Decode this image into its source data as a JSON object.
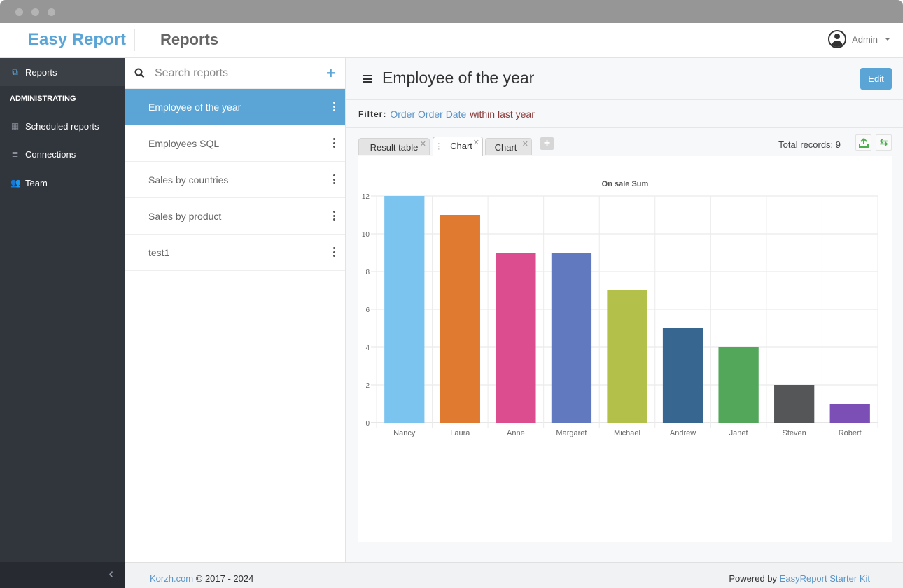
{
  "window": {
    "controls": [
      "close",
      "minimize",
      "maximize"
    ]
  },
  "header": {
    "brand": "Easy Report",
    "title": "Reports",
    "user": {
      "name": "Admin",
      "icon": "user-circle-icon"
    }
  },
  "sidebar": {
    "items": [
      {
        "label": "Reports",
        "icon": "reports-icon",
        "active": true
      }
    ],
    "section_heading": "ADMINISTRATING",
    "admin_items": [
      {
        "label": "Scheduled reports",
        "icon": "calendar-icon"
      },
      {
        "label": "Connections",
        "icon": "database-icon"
      },
      {
        "label": "Team",
        "icon": "users-icon"
      }
    ],
    "collapse_icon": "chevron-left-icon"
  },
  "report_list": {
    "search_placeholder": "Search reports",
    "items": [
      {
        "label": "Employee of the year",
        "active": true
      },
      {
        "label": "Employees SQL"
      },
      {
        "label": "Sales by countries"
      },
      {
        "label": "Sales by product"
      },
      {
        "label": "test1"
      }
    ]
  },
  "main": {
    "title": "Employee of the year",
    "edit_label": "Edit",
    "filter": {
      "label": "Filter:",
      "field": "Order Order Date",
      "operator": "within last year"
    },
    "tabs": [
      {
        "label": "Result table",
        "active": false
      },
      {
        "label": "Chart",
        "active": true
      },
      {
        "label": "Chart",
        "active": false
      }
    ],
    "total_records_label": "Total records: 9",
    "export_icon": "upload-icon",
    "refresh_icon": "refresh-icon"
  },
  "chart_data": {
    "type": "bar",
    "title": "On sale Sum",
    "categories": [
      "Nancy",
      "Laura",
      "Anne",
      "Margaret",
      "Michael",
      "Andrew",
      "Janet",
      "Steven",
      "Robert"
    ],
    "values": [
      12,
      11,
      9,
      9,
      7,
      5,
      4,
      2,
      1
    ],
    "colors": [
      "#7cc4f0",
      "#e07a30",
      "#db4d8f",
      "#6179bf",
      "#b3c14a",
      "#376790",
      "#52a75a",
      "#555658",
      "#7b4fb6"
    ],
    "xlabel": "",
    "ylabel": "",
    "ylim": [
      0,
      12
    ],
    "yticks": [
      0,
      2,
      4,
      6,
      8,
      10,
      12
    ],
    "grid": true,
    "legend": "none"
  },
  "footer": {
    "left_link": "Korzh.com",
    "left_text": "© 2017 - 2024",
    "right_text": "Powered by",
    "right_link": "EasyReport Starter Kit"
  }
}
